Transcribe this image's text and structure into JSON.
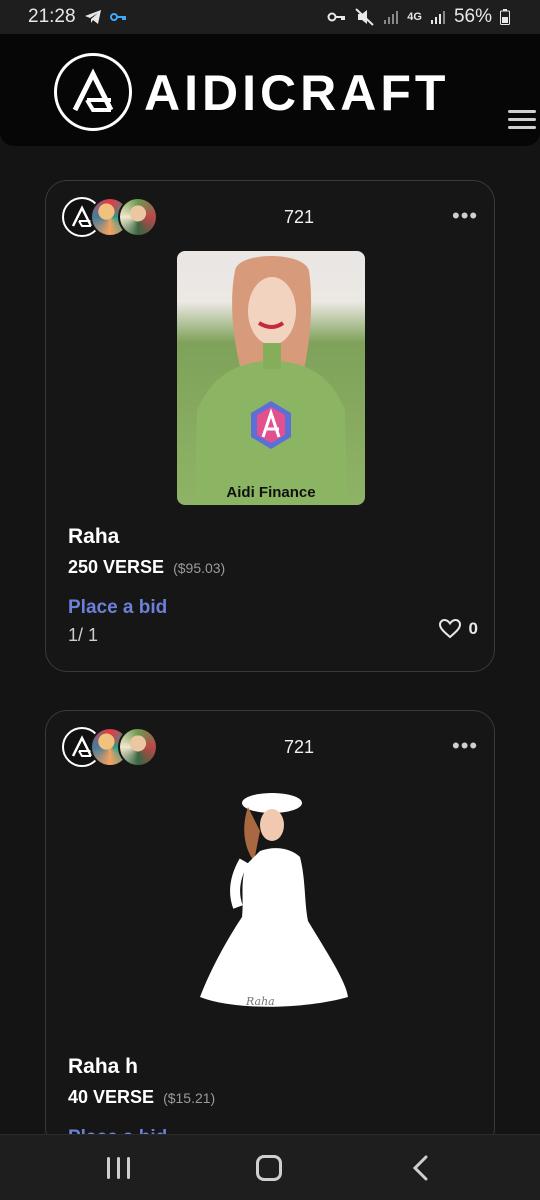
{
  "status_bar": {
    "time": "21:28",
    "battery": "56%",
    "network": "4G"
  },
  "header": {
    "brand": "AIDICRAFT"
  },
  "cards": [
    {
      "count": "721",
      "name": "Raha",
      "price": "250 VERSE",
      "price_usd": "($95.03)",
      "bid_label": "Place a bid",
      "edition": "1/ 1",
      "likes": "0",
      "art_caption": "Aidi Finance"
    },
    {
      "count": "721",
      "name": "Raha h",
      "price": "40 VERSE",
      "price_usd": "($15.21)",
      "bid_label": "Place a bid",
      "edition": "",
      "likes": "",
      "art_signature": "Raha"
    }
  ],
  "colors": {
    "background": "#141414",
    "accent": "#6b80d6",
    "card_border": "#3a3a3a"
  },
  "icons": [
    "telegram-icon",
    "key-icon",
    "mute-icon",
    "signal-icon",
    "battery-icon",
    "menu-icon",
    "more-icon",
    "heart-icon",
    "recent-apps-icon",
    "home-icon",
    "back-icon"
  ]
}
